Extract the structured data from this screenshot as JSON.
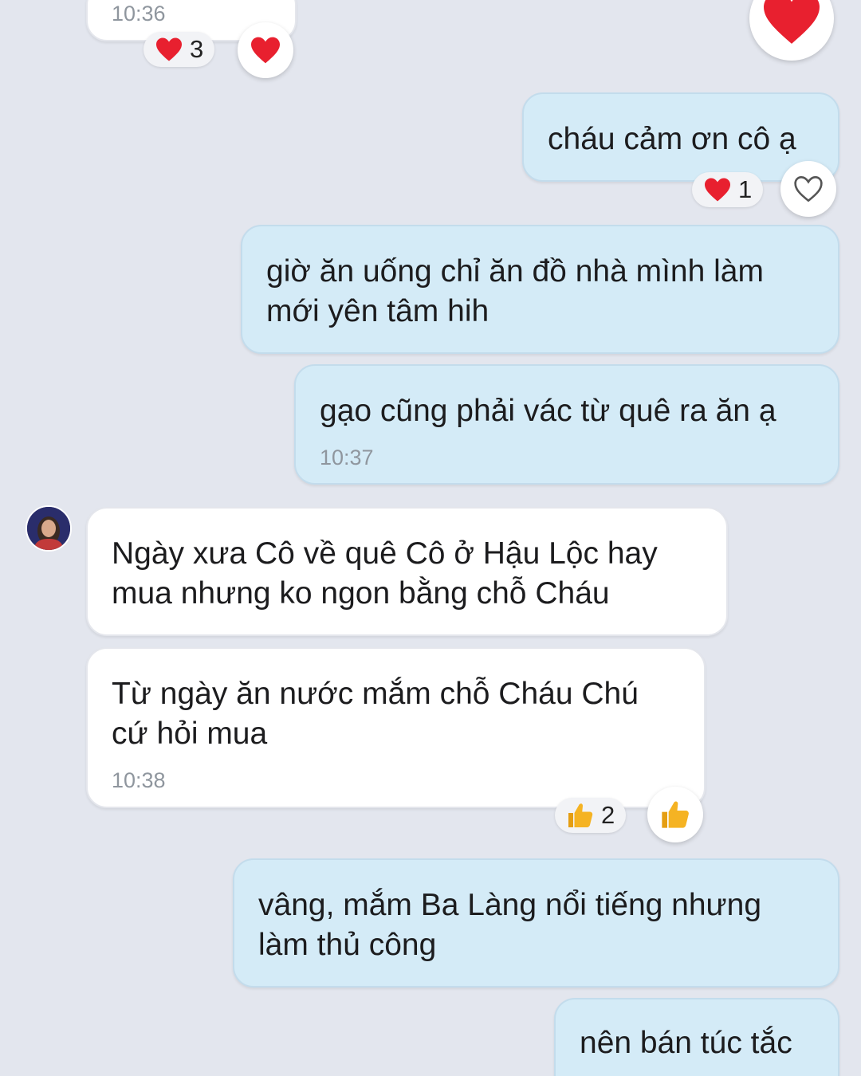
{
  "messages": [
    {
      "text": "cháu cảm ơn cô ạ"
    },
    {
      "text": "giờ ăn uống chỉ ăn đồ nhà mình làm\nmới yên tâm hih"
    },
    {
      "text": "gạo cũng phải vác từ quê ra ăn ạ",
      "time": "10:37"
    },
    {
      "text": "Ngày xưa Cô về quê Cô ở Hậu Lộc hay\nmua nhưng ko ngon bằng chỗ Cháu"
    },
    {
      "text": "Từ ngày ăn nước mắm chỗ Cháu Chú\ncứ hỏi mua",
      "time": "10:38"
    },
    {
      "text": "vâng, mắm Ba Làng nổi tiếng nhưng\nlàm thủ công"
    },
    {
      "text": "nên bán túc tắc"
    }
  ],
  "top_message": {
    "time": "10:36"
  },
  "reactions": {
    "top_count": "3",
    "thanks_count": "1",
    "thumbs_count": "2"
  },
  "colors": {
    "background": "#e3e6ee",
    "outgoing_bubble": "#d4ebf7",
    "incoming_bubble": "#ffffff",
    "heart": "#e8202f",
    "thumbs": "#f5b323"
  },
  "icons": [
    "heart-icon",
    "heart-outline-icon",
    "thumbs-up-icon",
    "avatar"
  ]
}
